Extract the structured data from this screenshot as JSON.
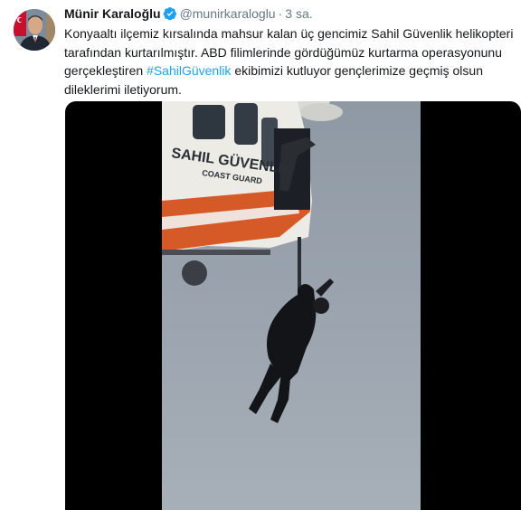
{
  "tweet": {
    "author_name": "Münir Karaloğlu",
    "author_handle": "@munirkaraloglu",
    "separator": "·",
    "timestamp": "3 sa.",
    "text_part1": "Konyaaltı ilçemiz kırsalında mahsur kalan üç gencimiz Sahil Güvenlik helikopteri tarafından kurtarılmıştır. ABD filimlerinde gördüğümüz kurtarma operasyonunu gerçekleştiren ",
    "hashtag": "#SahilGüvenlik",
    "text_part2": " ekibimizi kutluyor gençlerimize geçmiş olsun dileklerimi iletiyorum."
  },
  "media": {
    "helicopter_label": "SAHIL GÜVENLIK",
    "helicopter_sublabel": "COAST GUARD"
  },
  "colors": {
    "link": "#1da1f2",
    "secondary_text": "#657786",
    "verified_badge": "#1da1f2"
  }
}
